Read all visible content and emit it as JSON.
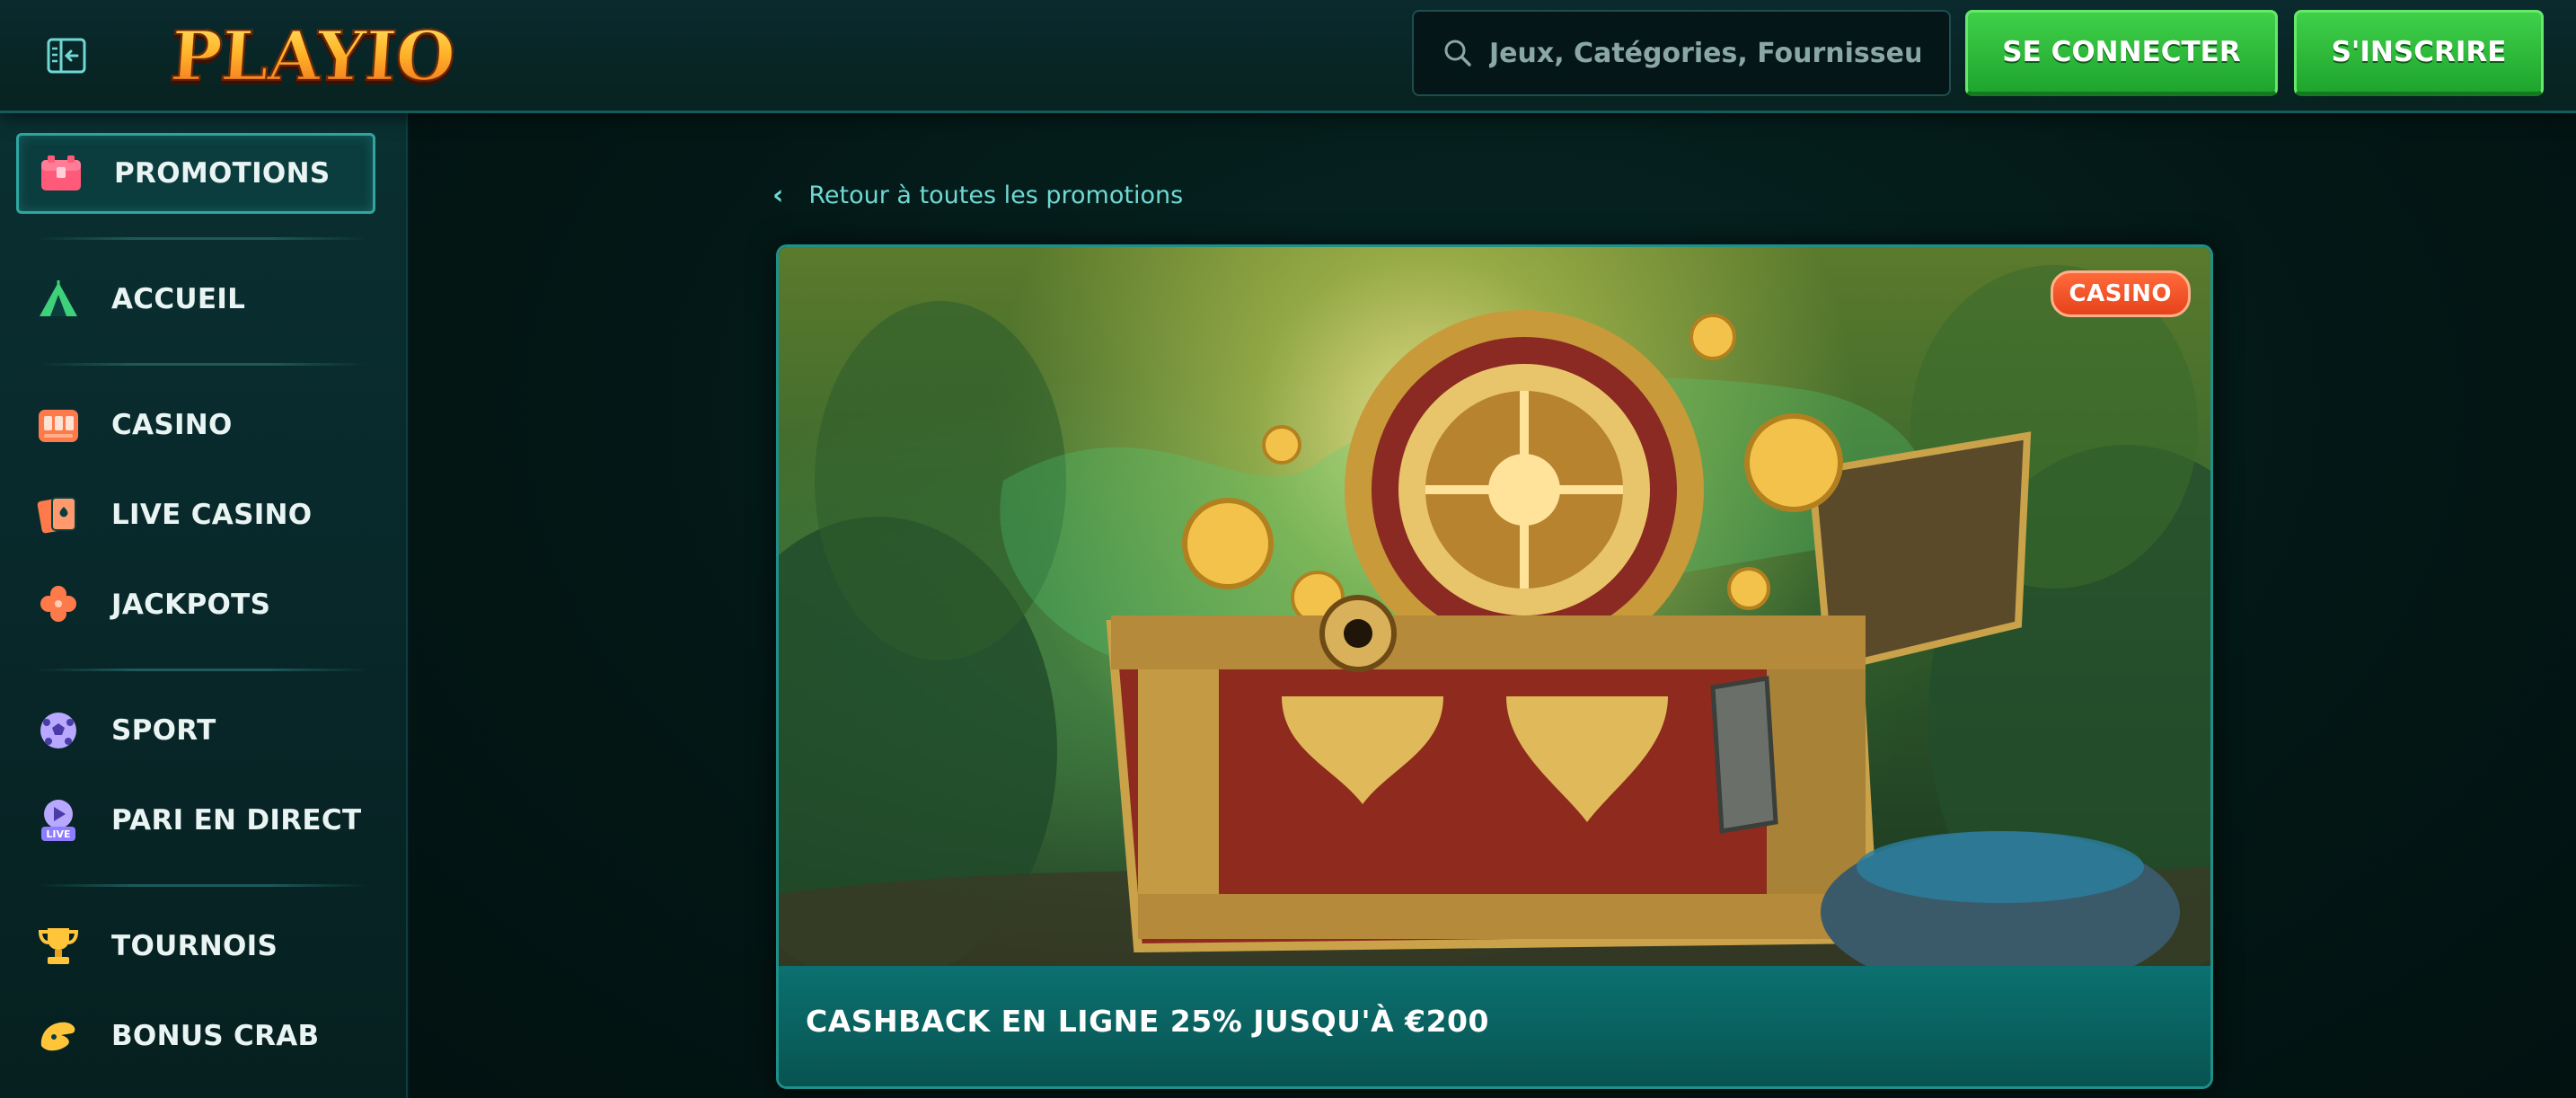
{
  "header": {
    "logo_text": "PLAYIO",
    "search_placeholder": "Jeux, Catégories, Fournisseurs",
    "login_label": "SE CONNECTER",
    "signup_label": "S'INSCRIRE"
  },
  "sidebar": {
    "items": [
      {
        "label": "PROMOTIONS",
        "icon": "treasure-chest-icon",
        "active": true
      },
      {
        "label": "ACCUEIL",
        "icon": "tent-icon"
      },
      {
        "label": "CASINO",
        "icon": "slot-machine-icon"
      },
      {
        "label": "LIVE CASINO",
        "icon": "playing-cards-icon"
      },
      {
        "label": "JACKPOTS",
        "icon": "clover-icon"
      },
      {
        "label": "SPORT",
        "icon": "soccer-ball-icon"
      },
      {
        "label": "PARI EN DIRECT",
        "icon": "live-play-icon"
      },
      {
        "label": "TOURNOIS",
        "icon": "trophy-icon"
      },
      {
        "label": "BONUS CRAB",
        "icon": "crab-claw-icon"
      }
    ]
  },
  "main": {
    "back_link": "Retour à toutes les promotions",
    "promo": {
      "badge": "CASINO",
      "title": "CASHBACK EN LIGNE 25% JUSQU'À €200"
    }
  },
  "colors": {
    "accent_teal": "#2fa6a0",
    "button_green": "#3fd04a",
    "badge_orange": "#e6421b"
  }
}
